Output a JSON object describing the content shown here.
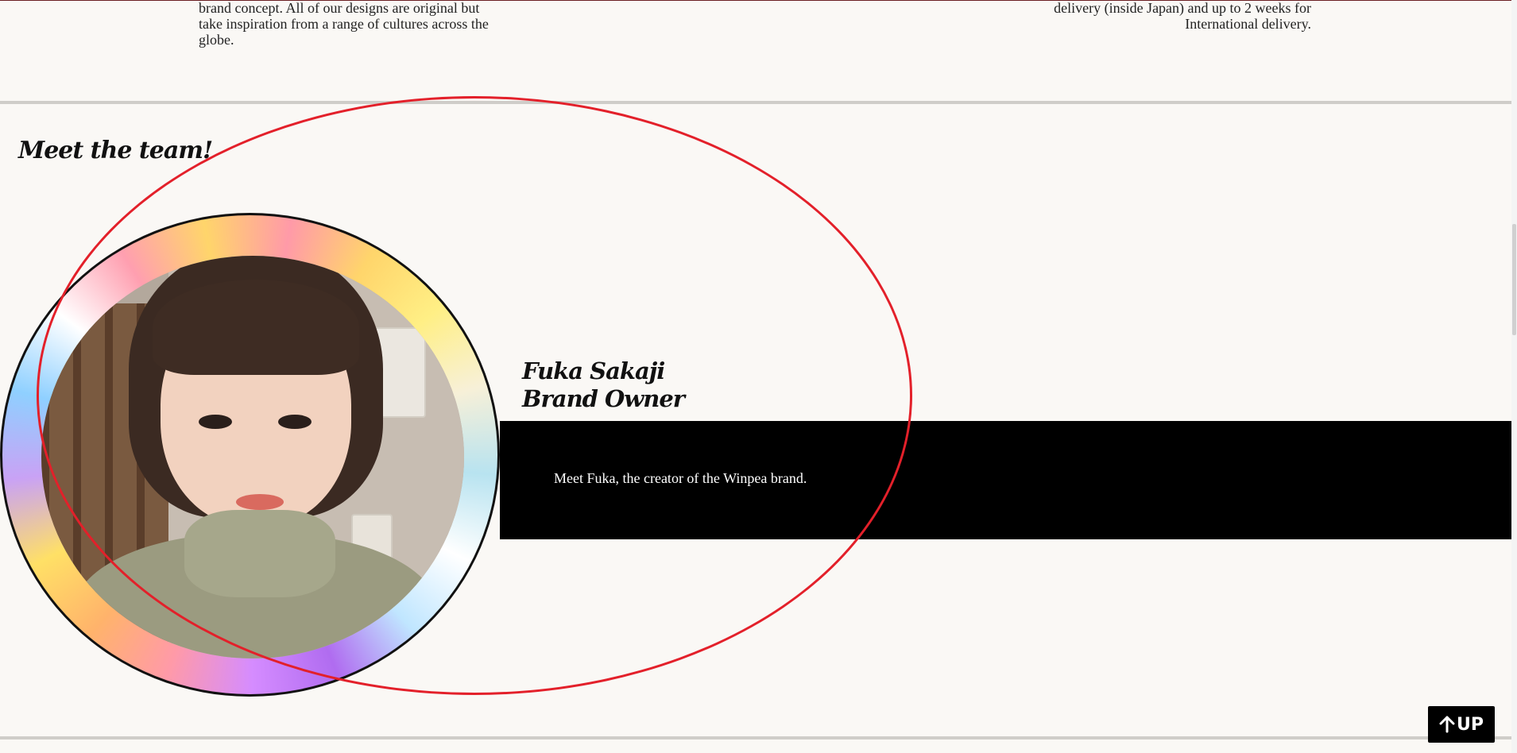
{
  "intro": {
    "left_text": "brand concept. All of our designs are original but take inspiration from a range of cultures across the globe.",
    "right_text": "delivery (inside Japan) and up to 2 weeks for International delivery."
  },
  "team": {
    "heading": "Meet the team!",
    "member": {
      "name": "Fuka Sakaji",
      "role": "Brand Owner",
      "bio": "Meet Fuka, the creator of the Winpea brand."
    }
  },
  "up_button": {
    "label": "UP",
    "icon": "arrow-up-icon"
  },
  "colors": {
    "background": "#faf8f5",
    "bio_band": "#000000",
    "annotation": "#e3202a"
  }
}
